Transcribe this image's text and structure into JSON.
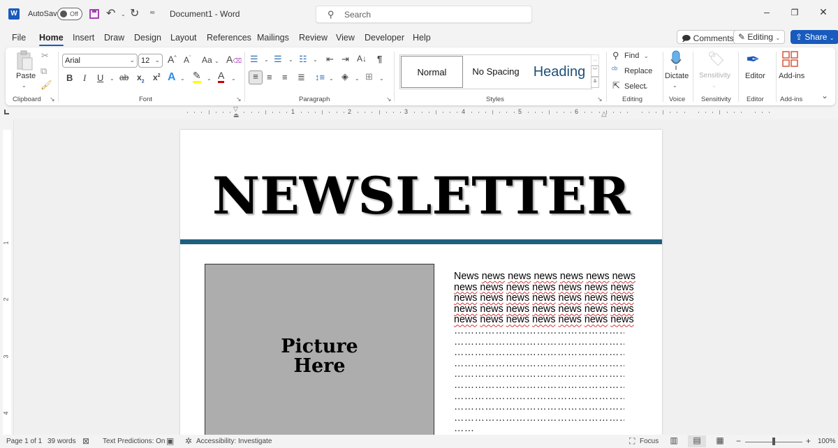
{
  "titlebar": {
    "app_icon": "word-logo-icon",
    "autosave_label": "AutoSave",
    "autosave_state": "Off",
    "document_title": "Document1  -  Word",
    "search_placeholder": "Search",
    "window_controls": [
      "minimize",
      "restore",
      "close"
    ]
  },
  "menu": {
    "tabs": [
      "File",
      "Home",
      "Insert",
      "Draw",
      "Design",
      "Layout",
      "References",
      "Mailings",
      "Review",
      "View",
      "Developer",
      "Help"
    ],
    "active_tab": "Home",
    "comments_label": "Comments",
    "editing_label": "Editing",
    "share_label": "Share"
  },
  "ribbon": {
    "clipboard": {
      "paste_label": "Paste",
      "group_label": "Clipboard"
    },
    "font": {
      "font_name": "Arial",
      "font_size": "12",
      "group_label": "Font",
      "buttons": [
        "Bold",
        "Italic",
        "Underline",
        "Strikethrough",
        "Subscript",
        "Superscript",
        "Text Effects",
        "Highlight",
        "Font Color"
      ],
      "bold_glyph": "B",
      "italic_glyph": "I",
      "underline_glyph": "U",
      "strike_glyph": "ab",
      "change_case_glyph": "Aa",
      "highlight_color": "#ffff00",
      "font_color": "#d00000"
    },
    "paragraph": {
      "group_label": "Paragraph",
      "sort_glyph": "A↓",
      "pilcrow": "¶"
    },
    "styles": {
      "group_label": "Styles",
      "items": [
        {
          "label": "Normal",
          "selected": true
        },
        {
          "label": "No Spacing",
          "selected": false
        },
        {
          "label": "Heading",
          "selected": false
        }
      ],
      "heading_color": "#1f4e79"
    },
    "editing": {
      "find_label": "Find",
      "replace_label": "Replace",
      "select_label": "Select",
      "group_label": "Editing"
    },
    "voice": {
      "dictate_label": "Dictate",
      "group_label": "Voice"
    },
    "sensitivity": {
      "label": "Sensitivity",
      "group_label": "Sensitivity"
    },
    "editor": {
      "label": "Editor",
      "group_label": "Editor"
    },
    "addins": {
      "label": "Add-ins",
      "group_label": "Add-ins"
    }
  },
  "ruler": {
    "horizontal_numbers": [
      "1",
      "2",
      "3",
      "4",
      "5",
      "6"
    ],
    "vertical_numbers": [
      "1",
      "2",
      "3",
      "4"
    ]
  },
  "document": {
    "masthead": "NEWSLETTER",
    "rule_color": "#1e5f80",
    "picture_placeholder_line1": "Picture",
    "picture_placeholder_line2": "Here",
    "news_lines": [
      [
        "News",
        "news",
        "news",
        "news",
        "news",
        "news",
        "news"
      ],
      [
        "news",
        "news",
        "news",
        "news",
        "news",
        "news",
        "news"
      ],
      [
        "news",
        "news",
        "news",
        "news",
        "news",
        "news",
        "news"
      ],
      [
        "news",
        "news",
        "news",
        "news",
        "news",
        "news",
        "news"
      ],
      [
        "news",
        "news",
        "news",
        "news",
        "news",
        "news",
        "news"
      ]
    ],
    "dot_lines": [
      "………………………………………………",
      "………………………………………………",
      "………………………………………………",
      "………………………………………………",
      "………………………………………………",
      "………………………………………………",
      "………………………………………………",
      "………………………………………………",
      "………………………………………………",
      "……"
    ]
  },
  "statusbar": {
    "page": "Page 1 of 1",
    "words": "39 words",
    "text_predictions": "Text Predictions: On",
    "accessibility": "Accessibility: Investigate",
    "focus_label": "Focus",
    "zoom_level": "100%",
    "zoom_fraction": 0.5,
    "active_view": "Print Layout"
  }
}
